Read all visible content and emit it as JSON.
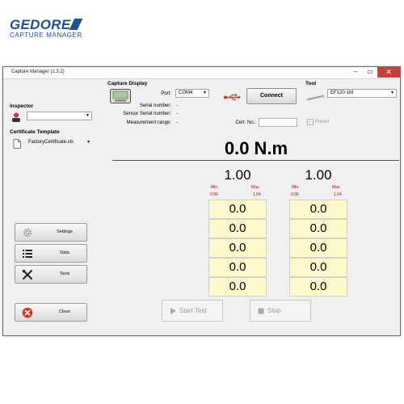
{
  "window": {
    "title": "Capture Manager (1.3.2)",
    "controls": {
      "minimize": "–",
      "maximize": "▭",
      "close": "✕"
    }
  },
  "logo": {
    "brand": "GEDORE",
    "subtitle": "CAPTURE MANAGER"
  },
  "inspector": {
    "label": "Inspector",
    "value": ""
  },
  "certificate_template": {
    "label": "Certificate Template",
    "value": "FactoryCertificate.xls"
  },
  "capture_display": {
    "label": "Capture Display",
    "port_label": "Port:",
    "port_value": "COM4",
    "serial_number_label": "Serial number:",
    "serial_number_value": "-",
    "sensor_serial_label": "Sensor Serial number:",
    "sensor_serial_value": "-",
    "measurement_range_label": "Measurement range:",
    "measurement_range_value": "-",
    "connect_label": "Connect"
  },
  "tool": {
    "label": "Tool",
    "value": "EF120-1M"
  },
  "cert_no": {
    "label": "Cert. No.:",
    "value": ""
  },
  "preset": {
    "label": "Preset",
    "checked": true
  },
  "reading": "0.0 N.m",
  "columns": [
    {
      "target": "1.00",
      "min_label": "Min.",
      "min_value": "0.96",
      "max_label": "Max.",
      "max_value": "1.04",
      "cells": [
        "0.0",
        "0.0",
        "0.0",
        "0.0",
        "0.0"
      ]
    },
    {
      "target": "1.00",
      "min_label": "Min.",
      "min_value": "0.96",
      "max_label": "Max.",
      "max_value": "1.04",
      "cells": [
        "0.0",
        "0.0",
        "0.0",
        "0.0",
        "0.0"
      ]
    }
  ],
  "sidebar_buttons": {
    "settings": "Settings",
    "data": "Data",
    "tools": "Tools",
    "close": "Close"
  },
  "actions": {
    "start_test": "Start Test",
    "stop": "Stop"
  },
  "colors": {
    "brand": "#1f4e9a",
    "cell_bg": "#fdf9cc",
    "min_max": "#c00000",
    "close_icon": "#d9342b"
  }
}
